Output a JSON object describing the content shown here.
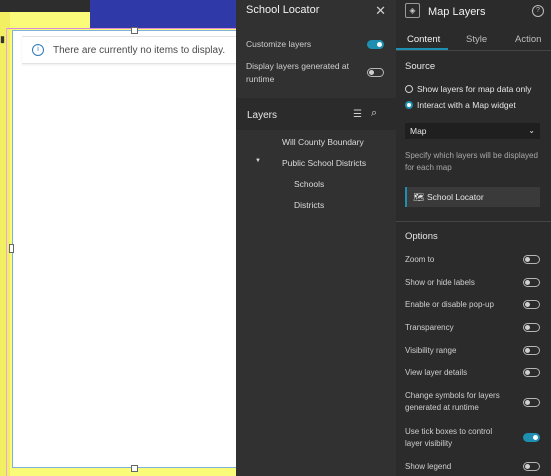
{
  "canvas": {
    "notice_text": "There are currently no items to display."
  },
  "locator_panel": {
    "title": "School Locator",
    "customize_layers_label": "Customize layers",
    "customize_layers_on": true,
    "runtime_layers_label": "Display layers generated at runtime",
    "runtime_layers_on": false,
    "layers_title": "Layers",
    "layers": [
      {
        "label": "Will County Boundary",
        "level": 0,
        "expanded": false
      },
      {
        "label": "Public School Districts",
        "level": 0,
        "expanded": true
      },
      {
        "label": "Schools",
        "level": 1
      },
      {
        "label": "Districts",
        "level": 1
      }
    ]
  },
  "settings_panel": {
    "title": "Map Layers",
    "tabs": [
      "Content",
      "Style",
      "Action"
    ],
    "active_tab": "Content",
    "source_heading": "Source",
    "source_options": [
      {
        "label": "Show layers for map data only",
        "selected": false
      },
      {
        "label": "Interact with a Map widget",
        "selected": true
      }
    ],
    "map_select_value": "Map",
    "help_text": "Specify which layers will be displayed for each map",
    "map_item_label": "School Locator",
    "options_heading": "Options",
    "options": [
      {
        "label": "Zoom to",
        "on": false
      },
      {
        "label": "Show or hide labels",
        "on": false
      },
      {
        "label": "Enable or disable pop-up",
        "on": false
      },
      {
        "label": "Transparency",
        "on": false
      },
      {
        "label": "Visibility range",
        "on": false
      },
      {
        "label": "View layer details",
        "on": false
      },
      {
        "label": "Change symbols for layers generated at runtime",
        "on": false
      },
      {
        "label": "Use tick boxes to control layer visibility",
        "on": true
      },
      {
        "label": "Show legend",
        "on": false
      }
    ]
  },
  "colors": {
    "accent": "#1e8fb0",
    "panel_dark": "#2b2b2b",
    "map_yellow": "#fbfb7a"
  }
}
